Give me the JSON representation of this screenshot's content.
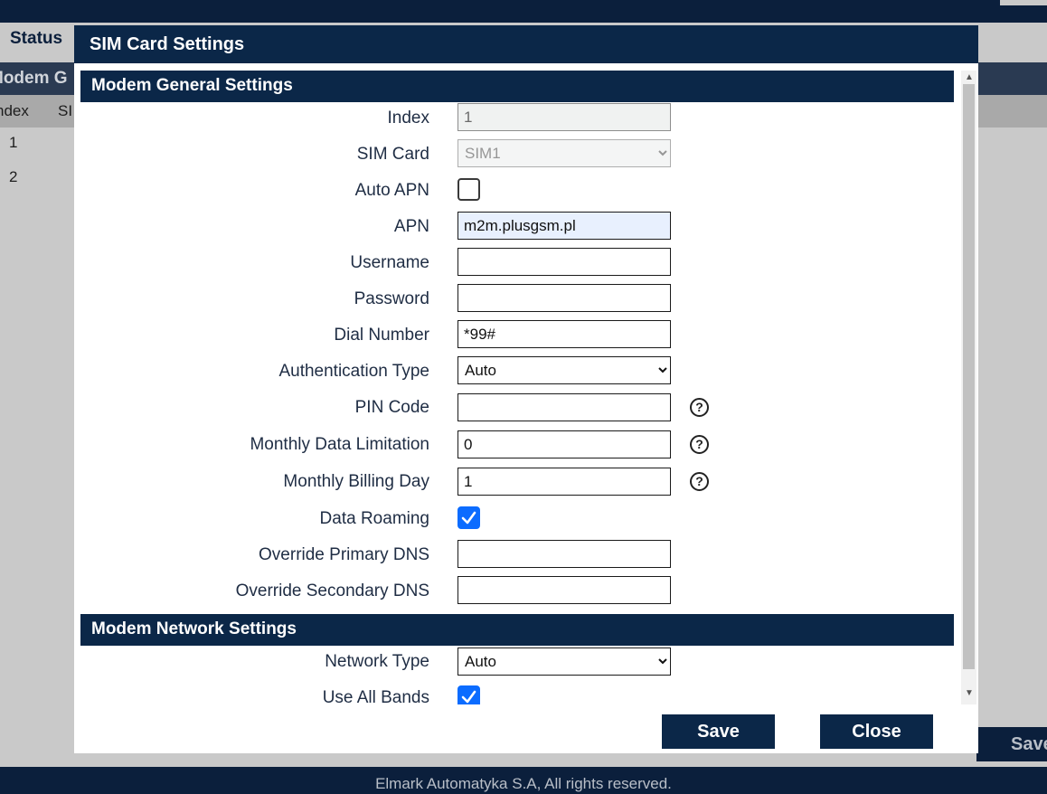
{
  "background": {
    "tab_status": "Status",
    "panel_title": "Modem G",
    "columns": [
      "ndex",
      "SI"
    ],
    "rows": [
      "1",
      "2"
    ],
    "save_label": "Save",
    "footer": "Elmark Automatyka S.A, All rights reserved."
  },
  "modal": {
    "title": "SIM Card Settings",
    "sections": {
      "general": "Modem General Settings",
      "network": "Modem Network Settings"
    },
    "fields": {
      "index": {
        "label": "Index",
        "value": "1"
      },
      "sim_card": {
        "label": "SIM Card",
        "value": "SIM1"
      },
      "auto_apn": {
        "label": "Auto APN",
        "checked": false
      },
      "apn": {
        "label": "APN",
        "value": "m2m.plusgsm.pl"
      },
      "username": {
        "label": "Username",
        "value": ""
      },
      "password": {
        "label": "Password",
        "value": ""
      },
      "dial_number": {
        "label": "Dial Number",
        "value": "*99#"
      },
      "auth_type": {
        "label": "Authentication Type",
        "value": "Auto"
      },
      "pin_code": {
        "label": "PIN Code",
        "value": ""
      },
      "monthly_limit": {
        "label": "Monthly Data Limitation",
        "value": "0"
      },
      "billing_day": {
        "label": "Monthly Billing Day",
        "value": "1"
      },
      "data_roaming": {
        "label": "Data Roaming",
        "checked": true
      },
      "primary_dns": {
        "label": "Override Primary DNS",
        "value": ""
      },
      "secondary_dns": {
        "label": "Override Secondary DNS",
        "value": ""
      },
      "network_type": {
        "label": "Network Type",
        "value": "Auto"
      },
      "use_all_bands": {
        "label": "Use All Bands",
        "checked": true
      }
    },
    "help_glyph": "?",
    "buttons": {
      "save": "Save",
      "close": "Close"
    }
  },
  "icons": {
    "help": "question-circle-icon",
    "check": "checkmark-icon"
  },
  "colors": {
    "header": "#0b2748",
    "checkbox_checked": "#0b6cff",
    "autofill": "#e8f0fe"
  }
}
